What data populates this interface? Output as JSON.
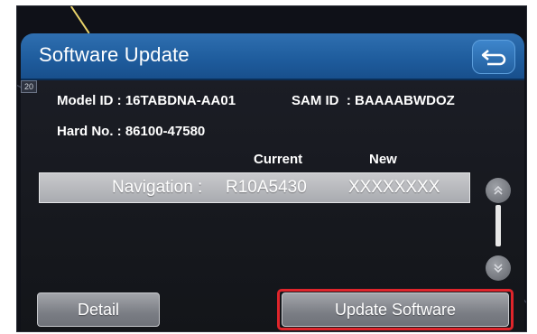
{
  "header": {
    "title": "Software Update",
    "back_icon": "return-arrow-icon"
  },
  "info": {
    "model_id": "Model ID : 16TABDNA-AA01",
    "sam_id": "SAM ID  : BAAAABWDOZ",
    "hard_no": "Hard No. : 86100-47580"
  },
  "table": {
    "col_current": "Current",
    "col_new": "New",
    "rows": [
      {
        "label": "Navigation :",
        "current": "R10A5430",
        "new": "XXXXXXXX"
      }
    ]
  },
  "scroll": {
    "up_icon": "scroll-up-icon",
    "down_icon": "scroll-down-icon"
  },
  "map_label": "20",
  "buttons": {
    "detail": "Detail",
    "update": "Update Software"
  },
  "colors": {
    "header_blue": "#1f5d9e",
    "highlight_red": "#e0252b"
  }
}
